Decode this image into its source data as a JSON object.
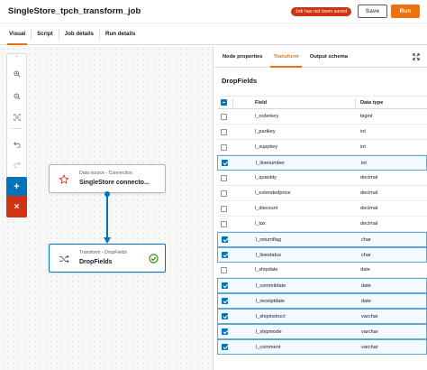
{
  "job": {
    "title": "SingleStore_tpch_transform_job"
  },
  "header": {
    "unsaved_badge": "Job has not been saved",
    "save_label": "Save",
    "run_label": "Run"
  },
  "colors": {
    "accent": "#ec7211",
    "primary": "#0073bb",
    "danger": "#d13212",
    "success": "#1d8102"
  },
  "main_tabs": [
    {
      "label": "Visual",
      "active": true
    },
    {
      "label": "Script"
    },
    {
      "label": "Job details"
    },
    {
      "label": "Run details"
    }
  ],
  "toolbar": {
    "icons": [
      "zoom-in-icon",
      "zoom-out-icon",
      "fit-to-screen-icon",
      "undo-icon",
      "redo-icon",
      "add-icon",
      "remove-icon"
    ],
    "add_label": "+",
    "remove_label": "×"
  },
  "nodes": {
    "source": {
      "type": "Data source - Connection",
      "name": "SingleStore connecto...",
      "icon": "connector-icon"
    },
    "transform": {
      "type": "Transform - DropFields",
      "name": "DropFields",
      "icon": "shuffle-icon",
      "status_icon": "check-circle-icon"
    }
  },
  "panel": {
    "tabs": [
      {
        "label": "Node properties"
      },
      {
        "label": "Transform",
        "active": true
      },
      {
        "label": "Output schema"
      }
    ],
    "section_title": "DropFields",
    "columns": {
      "field": "Field",
      "type": "Data type"
    },
    "fields": [
      {
        "name": "l_orderkey",
        "type": "bigint",
        "checked": false
      },
      {
        "name": "l_partkey",
        "type": "int",
        "checked": false
      },
      {
        "name": "l_suppkey",
        "type": "int",
        "checked": false
      },
      {
        "name": "l_linenumber",
        "type": "int",
        "checked": true
      },
      {
        "name": "l_quantity",
        "type": "decimal",
        "checked": false
      },
      {
        "name": "l_extendedprice",
        "type": "decimal",
        "checked": false
      },
      {
        "name": "l_discount",
        "type": "decimal",
        "checked": false
      },
      {
        "name": "l_tax",
        "type": "decimal",
        "checked": false
      },
      {
        "name": "l_returnflag",
        "type": "char",
        "checked": true
      },
      {
        "name": "l_linestatus",
        "type": "char",
        "checked": true
      },
      {
        "name": "l_shipdate",
        "type": "date",
        "checked": false
      },
      {
        "name": "l_commitdate",
        "type": "date",
        "checked": true
      },
      {
        "name": "l_receiptdate",
        "type": "date",
        "checked": true
      },
      {
        "name": "l_shipinstruct",
        "type": "varchar",
        "checked": true
      },
      {
        "name": "l_shipmode",
        "type": "varchar",
        "checked": true
      },
      {
        "name": "l_comment",
        "type": "varchar",
        "checked": true
      }
    ]
  }
}
